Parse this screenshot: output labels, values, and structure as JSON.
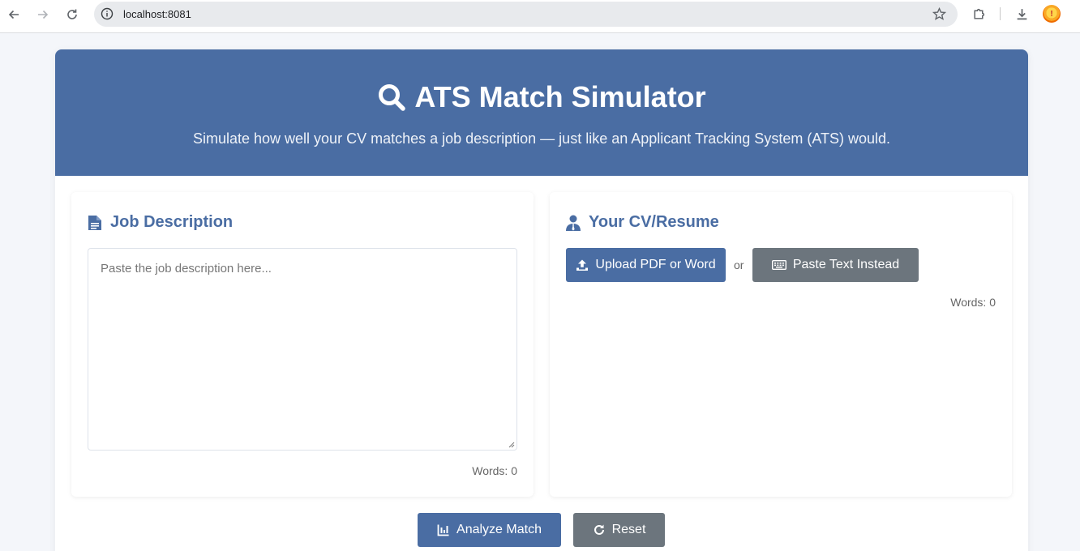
{
  "browser": {
    "url": "localhost:8081",
    "profile_initial": "!"
  },
  "header": {
    "title": "ATS Match Simulator",
    "subtitle": "Simulate how well your CV matches a job description — just like an Applicant Tracking System (ATS) would."
  },
  "job_description": {
    "heading": "Job Description",
    "placeholder": "Paste the job description here...",
    "value": "",
    "word_count": "Words: 0"
  },
  "cv": {
    "heading": "Your CV/Resume",
    "upload_label": "Upload PDF or Word",
    "or_label": "or",
    "paste_label": "Paste Text Instead",
    "word_count": "Words: 0"
  },
  "actions": {
    "analyze_label": "Analyze Match",
    "reset_label": "Reset"
  },
  "colors": {
    "primary": "#4a6da3",
    "secondary": "#6c757d",
    "background": "#f4f6fa"
  },
  "icons": {
    "title": "search-icon",
    "job_description": "document-icon",
    "cv": "user-tie-icon",
    "upload": "upload-icon",
    "paste": "keyboard-icon",
    "analyze": "chart-icon",
    "reset": "redo-icon"
  }
}
